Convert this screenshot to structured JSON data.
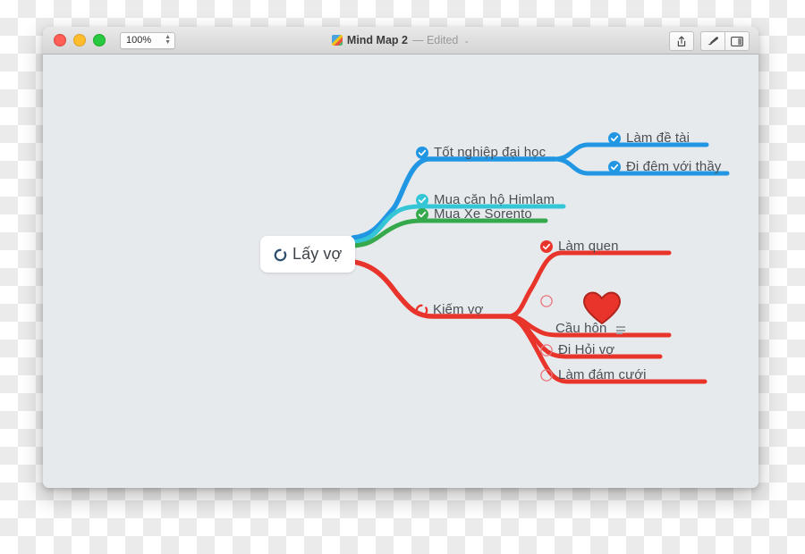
{
  "window": {
    "traffic_lights": [
      "close",
      "minimize",
      "zoom"
    ],
    "zoom_level": "100%",
    "doc_title": "Mind Map 2",
    "doc_state": "— Edited",
    "chevron": "⌄",
    "toolbar_buttons": [
      {
        "name": "share-button",
        "icon": "share-icon"
      },
      {
        "name": "format-brush-button",
        "icon": "brush-icon"
      },
      {
        "name": "sidebar-toggle-button",
        "icon": "sidebar-icon"
      }
    ]
  },
  "mindmap": {
    "central": {
      "label": "Lấy vợ",
      "bullet": "progress-ring",
      "bullet_color": "#2f4f6f"
    },
    "branches": [
      {
        "id": "tot-nghiep",
        "label": "Tốt nghiệp đại học",
        "bullet": "check-filled",
        "color": "#2196e3",
        "children": [
          {
            "id": "lam-de-tai",
            "label": "Làm đề tài",
            "bullet": "check-filled",
            "color": "#2196e3"
          },
          {
            "id": "di-dem-voi-thay",
            "label": "Đi đêm với thầy",
            "bullet": "check-filled",
            "color": "#2196e3"
          }
        ]
      },
      {
        "id": "mua-can-ho",
        "label": "Mua căn hộ Himlam",
        "bullet": "check-filled",
        "color": "#34c6d6",
        "children": []
      },
      {
        "id": "mua-xe",
        "label": "Mua Xe Sorento",
        "bullet": "check-filled",
        "color": "#35a94b",
        "children": []
      },
      {
        "id": "kiem-vo",
        "label": "Kiếm vợ",
        "bullet": "progress-ring",
        "color": "#e8342b",
        "children": [
          {
            "id": "lam-quen",
            "label": "Làm quen",
            "bullet": "check-filled",
            "color": "#e8342b"
          },
          {
            "id": "heart",
            "label": "",
            "bullet": "empty-ring",
            "color": "#e8342b",
            "image": "heart-emoji"
          },
          {
            "id": "cau-hon",
            "label": "Cầu hôn",
            "bullet": "none",
            "color": "#e8342b",
            "note": true
          },
          {
            "id": "di-hoi-vo",
            "label": "Đi Hỏi vợ",
            "bullet": "empty-ring",
            "color": "#e8342b"
          },
          {
            "id": "lam-dam-cuoi",
            "label": "Làm đám cưới",
            "bullet": "empty-ring",
            "color": "#e8342b"
          }
        ]
      }
    ]
  },
  "colors": {
    "blue": "#2196e3",
    "cyan": "#34c6d6",
    "green": "#35a94b",
    "red": "#e8342b",
    "canvas": "#e7eaed",
    "text": "#4a4f55"
  }
}
